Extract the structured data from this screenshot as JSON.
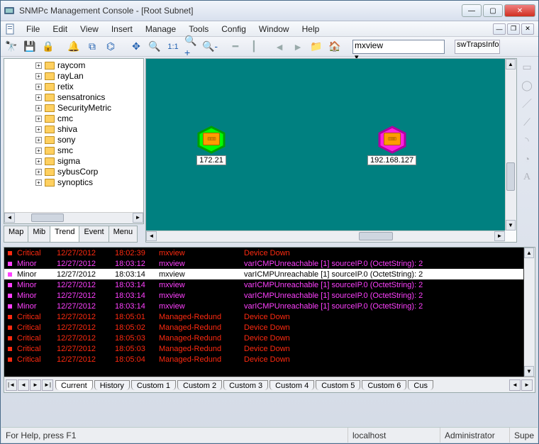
{
  "title": "SNMPc Management Console - [Root Subnet]",
  "menu": {
    "file": "File",
    "edit": "Edit",
    "view": "View",
    "insert": "Insert",
    "manage": "Manage",
    "tools": "Tools",
    "config": "Config",
    "window": "Window",
    "help": "Help"
  },
  "toolbar": {
    "zoom11": "1:1",
    "select_value": "mxview",
    "info_value": "swTrapsInfo"
  },
  "tree": {
    "items": [
      {
        "label": "raycom"
      },
      {
        "label": "rayLan"
      },
      {
        "label": "retix"
      },
      {
        "label": "sensatronics"
      },
      {
        "label": "SecurityMetric"
      },
      {
        "label": "cmc"
      },
      {
        "label": "shiva"
      },
      {
        "label": "sony"
      },
      {
        "label": "smc"
      },
      {
        "label": "sigma"
      },
      {
        "label": "sybusCorp"
      },
      {
        "label": "synoptics"
      }
    ]
  },
  "left_tabs": {
    "map": "Map",
    "mib": "Mib",
    "trend": "Trend",
    "event": "Event",
    "menu": "Menu"
  },
  "nodes": {
    "a": {
      "label": "172.21",
      "color": "#00ff00"
    },
    "b": {
      "label": "192.168.127",
      "color": "#ff20e0"
    }
  },
  "events": [
    {
      "sev": "Critical",
      "cls": "sev-critical",
      "dot": "red",
      "date": "12/27/2012",
      "time": "18:02:39",
      "src": "mxview",
      "msg": "Device Down"
    },
    {
      "sev": "Minor",
      "cls": "sev-minor",
      "dot": "mag",
      "date": "12/27/2012",
      "time": "18:03:12",
      "src": "mxview",
      "msg": "varICMPUnreachable [1] sourceIP.0 (OctetString): 2"
    },
    {
      "sev": "Minor",
      "cls": "sev-sel",
      "dot": "mag",
      "date": "12/27/2012",
      "time": "18:03:14",
      "src": "mxview",
      "msg": "varICMPUnreachable [1] sourceIP.0 (OctetString): 2",
      "sel": true
    },
    {
      "sev": "Minor",
      "cls": "sev-minor",
      "dot": "mag",
      "date": "12/27/2012",
      "time": "18:03:14",
      "src": "mxview",
      "msg": "varICMPUnreachable [1] sourceIP.0 (OctetString): 2"
    },
    {
      "sev": "Minor",
      "cls": "sev-minor",
      "dot": "mag",
      "date": "12/27/2012",
      "time": "18:03:14",
      "src": "mxview",
      "msg": "varICMPUnreachable [1] sourceIP.0 (OctetString): 2"
    },
    {
      "sev": "Minor",
      "cls": "sev-minor",
      "dot": "mag",
      "date": "12/27/2012",
      "time": "18:03:14",
      "src": "mxview",
      "msg": "varICMPUnreachable [1] sourceIP.0 (OctetString): 2"
    },
    {
      "sev": "Critical",
      "cls": "sev-critical",
      "dot": "red",
      "date": "12/27/2012",
      "time": "18:05:01",
      "src": "Managed-Redund",
      "msg": "Device Down"
    },
    {
      "sev": "Critical",
      "cls": "sev-critical",
      "dot": "red",
      "date": "12/27/2012",
      "time": "18:05:02",
      "src": "Managed-Redund",
      "msg": "Device Down"
    },
    {
      "sev": "Critical",
      "cls": "sev-critical",
      "dot": "red",
      "date": "12/27/2012",
      "time": "18:05:03",
      "src": "Managed-Redund",
      "msg": "Device Down"
    },
    {
      "sev": "Critical",
      "cls": "sev-critical",
      "dot": "red",
      "date": "12/27/2012",
      "time": "18:05:03",
      "src": "Managed-Redund",
      "msg": "Device Down"
    },
    {
      "sev": "Critical",
      "cls": "sev-critical",
      "dot": "red",
      "date": "12/27/2012",
      "time": "18:05:04",
      "src": "Managed-Redund",
      "msg": "Device Down"
    }
  ],
  "event_tabs": {
    "current": "Current",
    "history": "History",
    "c1": "Custom 1",
    "c2": "Custom 2",
    "c3": "Custom 3",
    "c4": "Custom 4",
    "c5": "Custom 5",
    "c6": "Custom 6",
    "c7": "Cus"
  },
  "status": {
    "help": "For Help, press F1",
    "host": "localhost",
    "user": "Administrator",
    "role": "Supe"
  }
}
